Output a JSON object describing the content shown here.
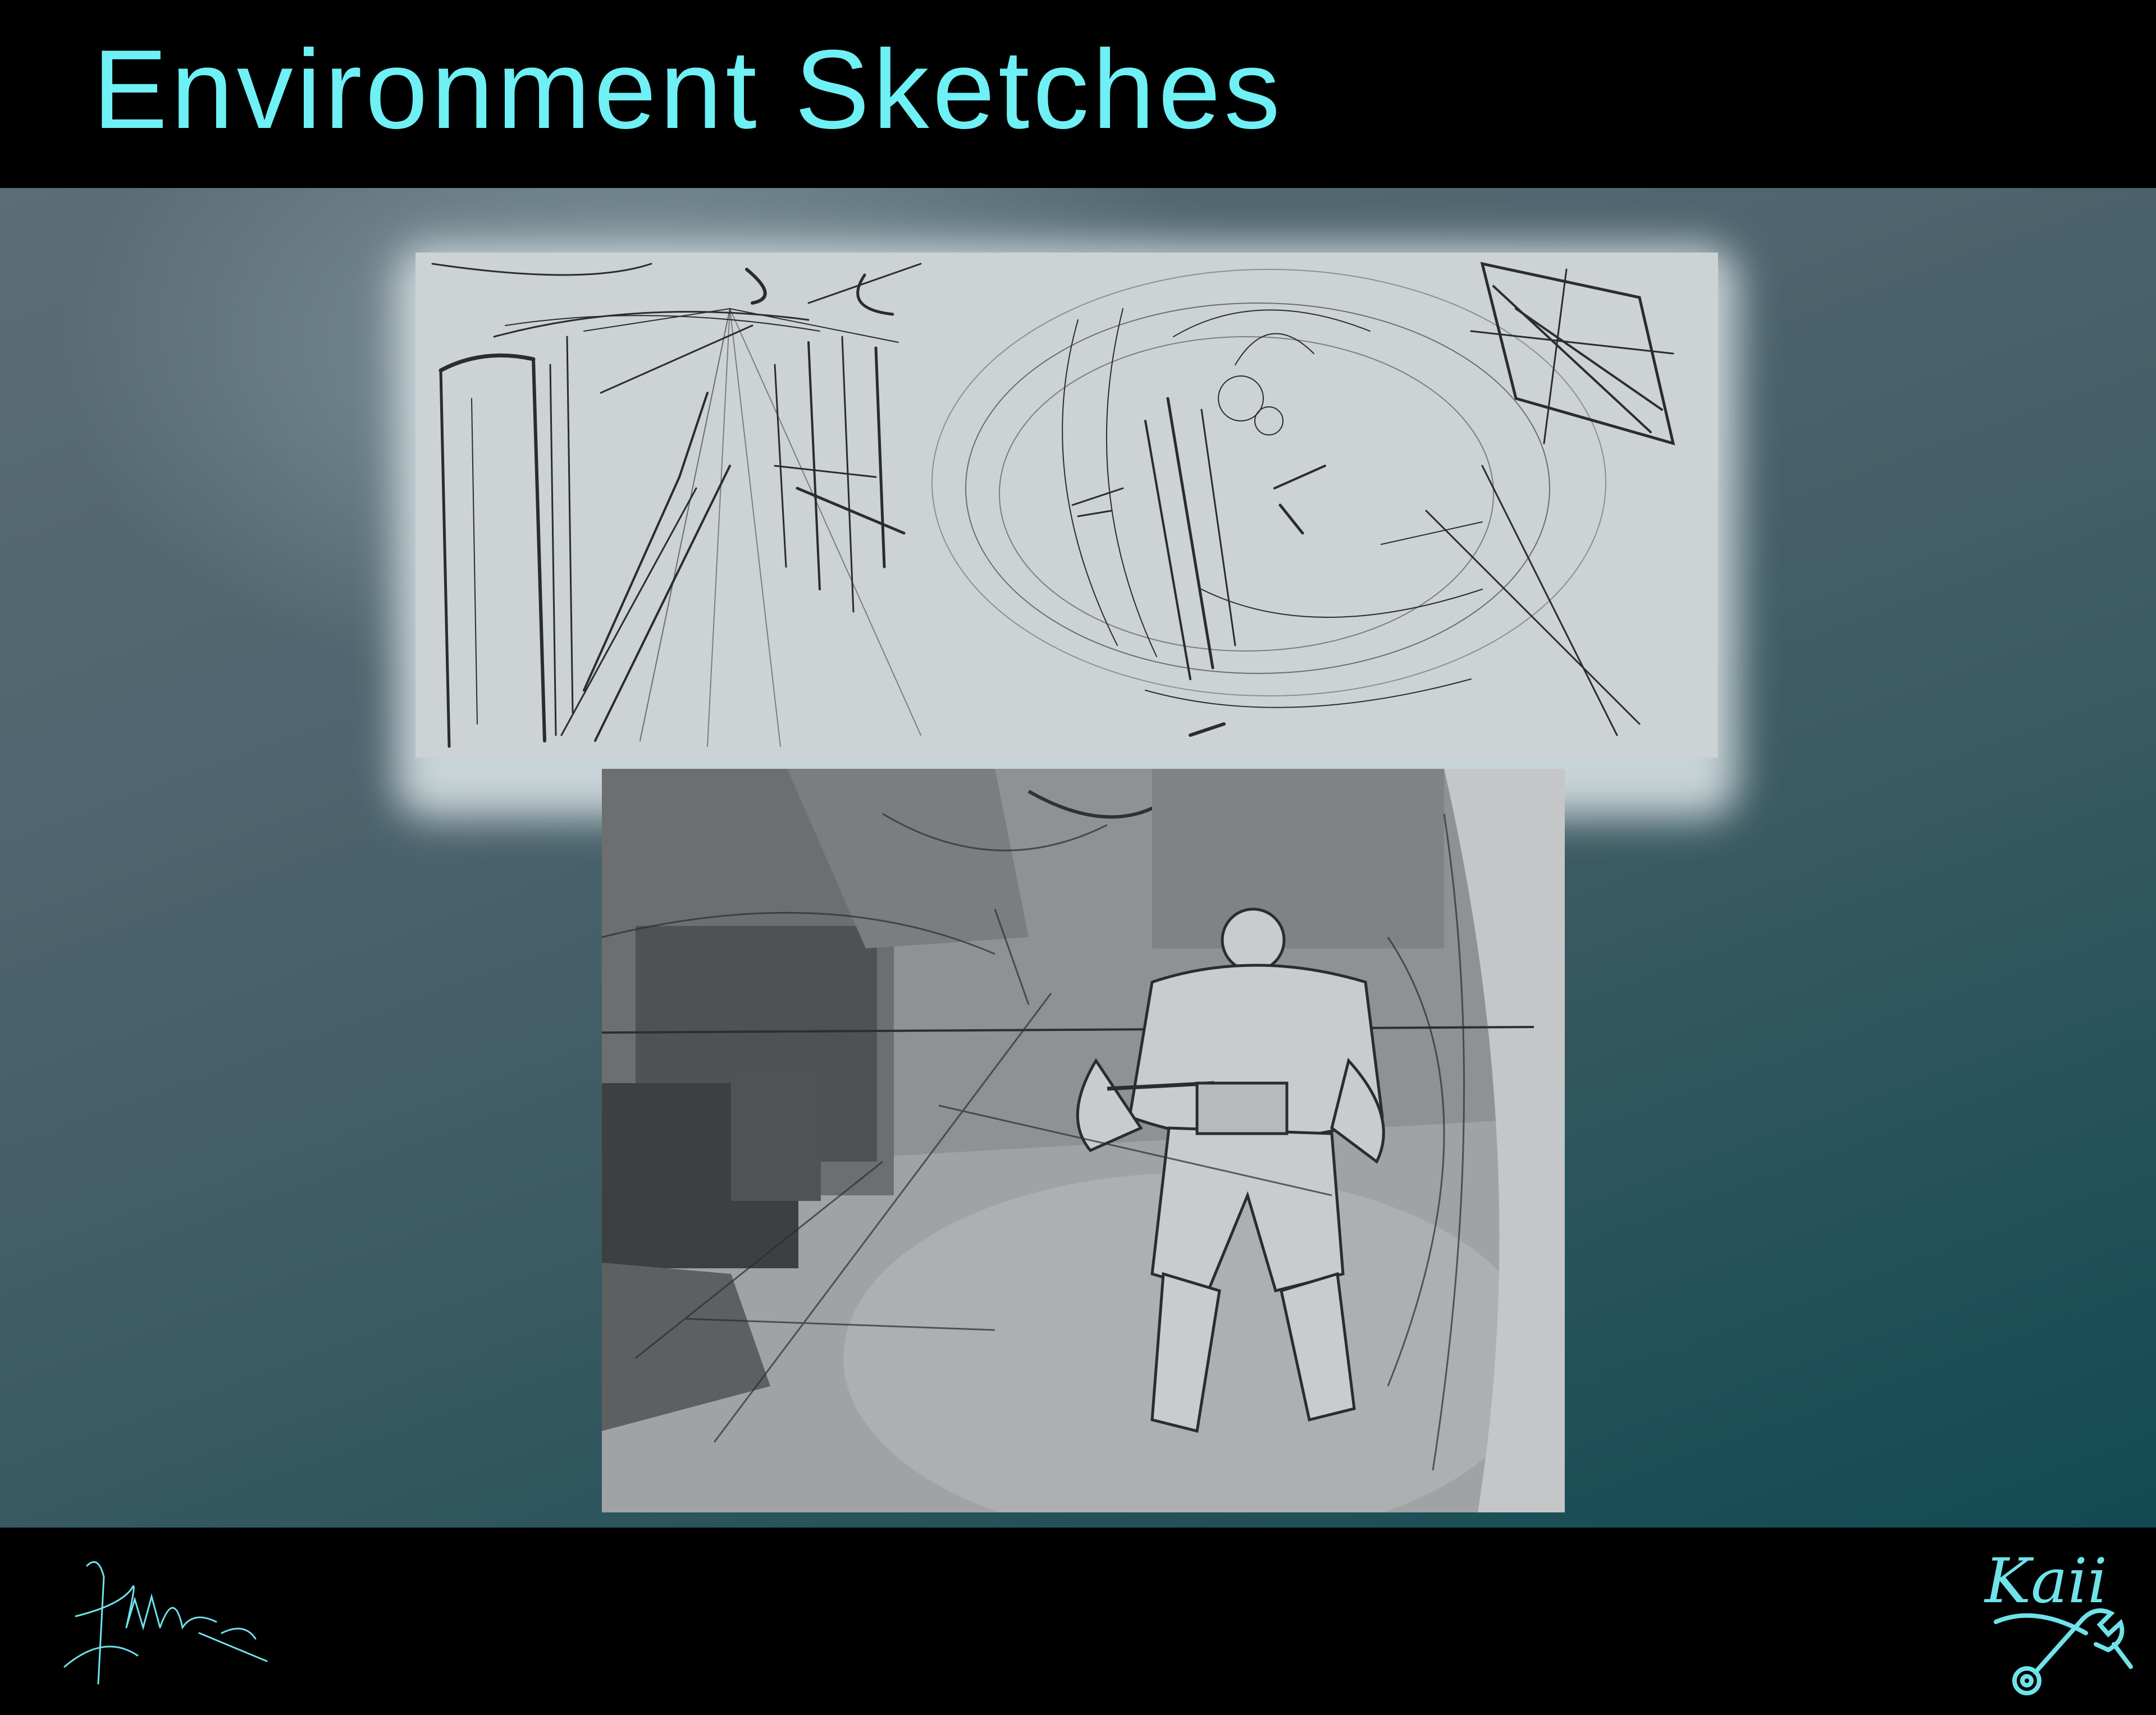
{
  "header": {
    "title": "Environment Sketches"
  },
  "colors": {
    "title": "#6ff0f4",
    "bars": "#000000",
    "accent": "#6fe3ea",
    "paper": "#cdd2d4"
  },
  "sketches": [
    {
      "name": "corridor-and-vortex-thumbnails",
      "kind": "pencil-line-sketch"
    },
    {
      "name": "armored-figure-value-study",
      "kind": "grayscale-value-sketch"
    }
  ],
  "footer": {
    "signature": {
      "kind": "handwritten-signature"
    },
    "logo": {
      "text": "Kaii",
      "icon": "wrench-icon"
    }
  }
}
